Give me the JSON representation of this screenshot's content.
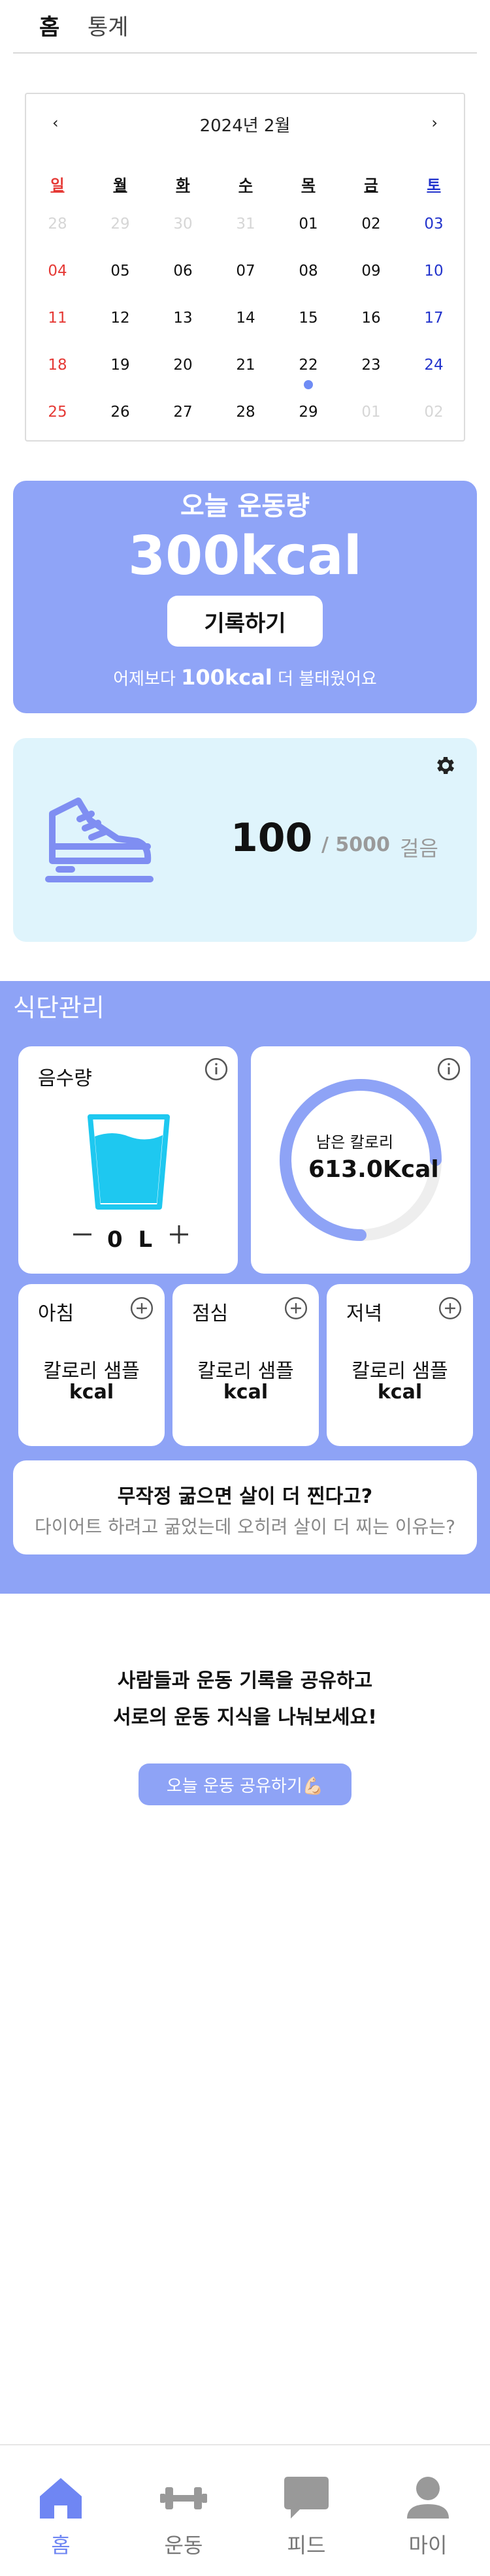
{
  "top_tabs": {
    "home": "홈",
    "stats": "통계"
  },
  "calendar": {
    "prev": "‹",
    "next": "›",
    "month_label": "2024년 2월",
    "weekdays": [
      "일",
      "월",
      "화",
      "수",
      "목",
      "금",
      "토"
    ],
    "weeks": [
      [
        "28",
        "29",
        "30",
        "31",
        "01",
        "02",
        "03"
      ],
      [
        "04",
        "05",
        "06",
        "07",
        "08",
        "09",
        "10"
      ],
      [
        "11",
        "12",
        "13",
        "14",
        "15",
        "16",
        "17"
      ],
      [
        "18",
        "19",
        "20",
        "21",
        "22",
        "23",
        "24"
      ],
      [
        "25",
        "26",
        "27",
        "28",
        "29",
        "01",
        "02"
      ]
    ],
    "marked_day": "22"
  },
  "exercise": {
    "title": "오늘 운동량",
    "kcal": "300kcal",
    "record_button": "기록하기",
    "compare_prefix": "어제보다 ",
    "compare_value": "100kcal",
    "compare_suffix": " 더 불태웠어요"
  },
  "steps": {
    "current": "100",
    "goal": "/ 5000",
    "unit": "걸음"
  },
  "diet": {
    "title": "식단관리",
    "water": {
      "label": "음수량",
      "value": "0 L",
      "minus": "−",
      "plus": "+"
    },
    "calories": {
      "label": "남은 칼로리",
      "value": "613.0Kcal",
      "progress": 0.75
    },
    "meals": [
      {
        "name": "아침",
        "sample": "칼로리 샘플",
        "kcal": "kcal"
      },
      {
        "name": "점심",
        "sample": "칼로리 샘플",
        "kcal": "kcal"
      },
      {
        "name": "저녁",
        "sample": "칼로리 샘플",
        "kcal": "kcal"
      }
    ],
    "article": {
      "title": "무작정 굶으면 살이 더 찐다고?",
      "subtitle": "다이어트 하려고 굶었는데 오히려 살이 더 찌는 이유는?"
    }
  },
  "share": {
    "line1": "사람들과 운동 기록을 공유하고",
    "line2": "서로의 운동 지식을 나눠보세요!",
    "button": "오늘 운동 공유하기💪🏻"
  },
  "bottom_nav": [
    {
      "label": "홈",
      "icon": "home-icon"
    },
    {
      "label": "운동",
      "icon": "dumbbell-icon"
    },
    {
      "label": "피드",
      "icon": "chat-icon"
    },
    {
      "label": "마이",
      "icon": "user-icon"
    }
  ],
  "colors": {
    "accent": "#8ea3f6",
    "sunday": "#e53935",
    "saturday": "#2233cc",
    "steps_bg": "#dff4fc",
    "water": "#1ec8f0"
  }
}
